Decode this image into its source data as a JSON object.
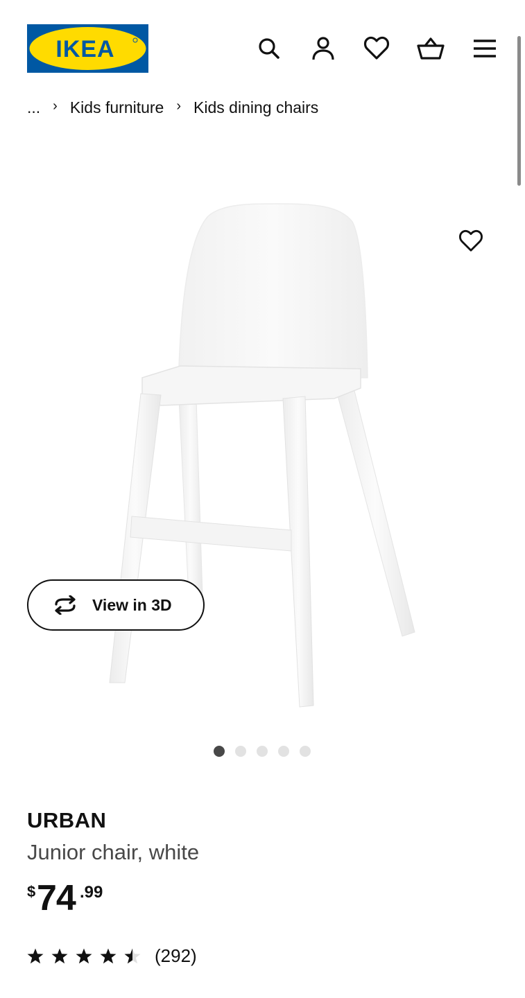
{
  "header": {
    "logo_text": "IKEA",
    "brand_colors": {
      "blue": "#0058a3",
      "yellow": "#ffdb00"
    },
    "icons": [
      "search-icon",
      "account-icon",
      "heart-icon",
      "basket-icon",
      "menu-icon"
    ]
  },
  "breadcrumb": {
    "ellipsis": "...",
    "items": [
      "Kids furniture",
      "Kids dining chairs"
    ]
  },
  "gallery": {
    "view_3d_label": "View in 3D",
    "dots_total": 5,
    "active_dot": 1
  },
  "product": {
    "name": "URBAN",
    "description": "Junior chair, white",
    "price": {
      "currency": "$",
      "integer": "74",
      "decimal": ".99"
    },
    "rating": {
      "stars": 4.5,
      "max": 5,
      "review_count": "(292)"
    }
  }
}
